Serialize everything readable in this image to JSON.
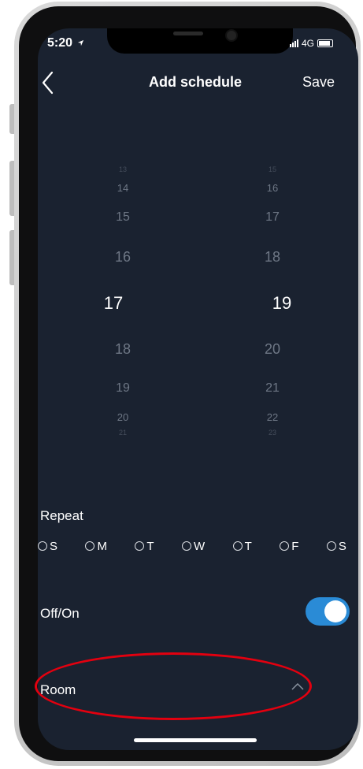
{
  "status": {
    "time": "5:20",
    "network": "4G",
    "icons": [
      "location-arrow-icon",
      "signal-bars-icon",
      "battery-icon"
    ]
  },
  "header": {
    "title": "Add schedule",
    "save_label": "Save",
    "back_icon": "chevron-left-icon"
  },
  "picker": {
    "hours": [
      "13",
      "14",
      "15",
      "16",
      "17",
      "18",
      "19",
      "20",
      "21"
    ],
    "minutes": [
      "15",
      "16",
      "17",
      "18",
      "19",
      "20",
      "21",
      "22",
      "23"
    ],
    "selected_hour": "17",
    "selected_minute": "19"
  },
  "repeat": {
    "label": "Repeat",
    "days": [
      {
        "label": "S",
        "checked": false
      },
      {
        "label": "M",
        "checked": false
      },
      {
        "label": "T",
        "checked": false
      },
      {
        "label": "W",
        "checked": false
      },
      {
        "label": "T",
        "checked": false
      },
      {
        "label": "F",
        "checked": false
      },
      {
        "label": "S",
        "checked": false
      }
    ]
  },
  "power": {
    "label": "Off/On",
    "on": true
  },
  "room": {
    "label": "Room",
    "icon": "chevron-up-icon"
  },
  "colors": {
    "screen_bg": "#1a2230",
    "toggle_on": "#2a8bd6",
    "highlight": "#e3000f"
  }
}
